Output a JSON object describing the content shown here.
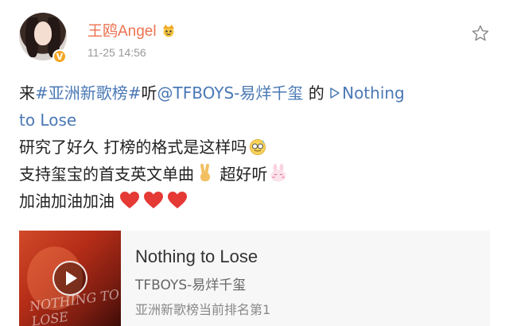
{
  "user": {
    "name": "王鸥Angel",
    "timestamp": "11-25 14:56",
    "verified_badge": "V",
    "name_emoji_icon": "crown-icon"
  },
  "post": {
    "line1_prefix": "来",
    "hashtag": "#亚洲新歌榜#",
    "line1_mid": "听",
    "mention": "@TFBOYS-易烊千玺",
    "line1_de": " 的",
    "song_link_icon": "play-triangle-icon",
    "song_link_part1": "Nothing",
    "song_link_part2": "to Lose",
    "line2": "研究了好久 打榜的格式是这样吗",
    "line2_emoji": "sweat-smile-emoji",
    "line3": "支持玺宝的首支英文单曲",
    "line3_emoji1": "victory-hand-emoji",
    "line3_mid": " 超好听",
    "line3_emoji2": "bunny-emoji",
    "line4": "加油加油加油",
    "line4_emoji": "heart-emoji",
    "heart_count": 3
  },
  "card": {
    "title": "Nothing to Lose",
    "artist": "TFBOYS-易烊千玺",
    "rank_text": "亚洲新歌榜当前排名第1",
    "cover_text": "NOTHING TO LOSE"
  },
  "colors": {
    "username": "#eb7350",
    "link": "#4a78b5",
    "timestamp": "#999999",
    "heart": "#e53935"
  }
}
